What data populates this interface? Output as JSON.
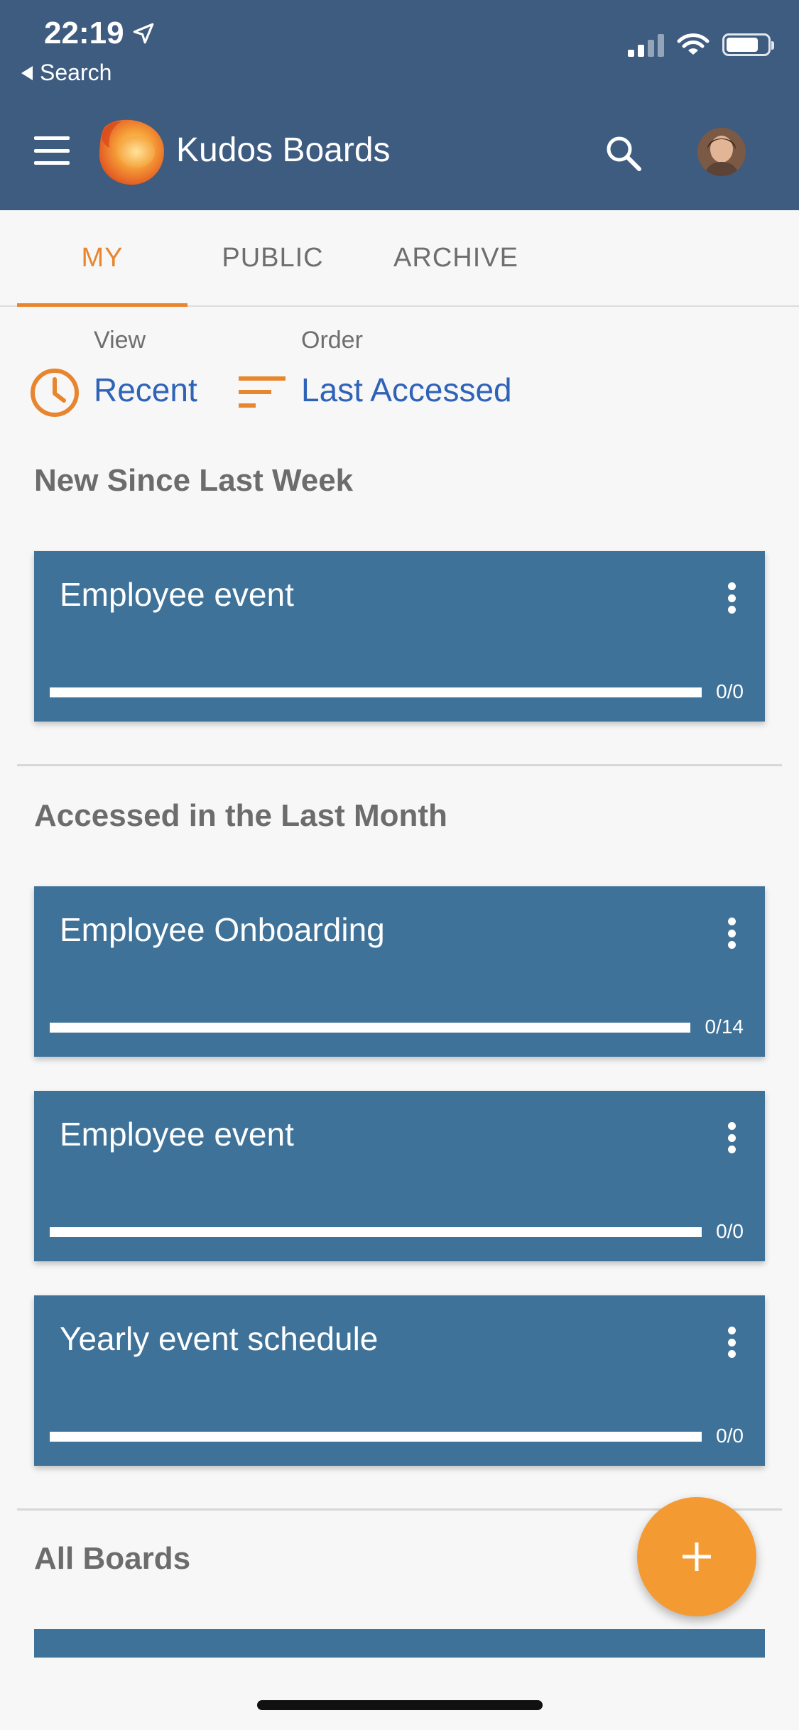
{
  "status_bar": {
    "time": "22:19",
    "back_label": "Search"
  },
  "app_bar": {
    "title": "Kudos Boards"
  },
  "tabs": [
    {
      "label": "MY",
      "active": true
    },
    {
      "label": "PUBLIC",
      "active": false
    },
    {
      "label": "ARCHIVE",
      "active": false
    }
  ],
  "filters": {
    "view_label": "View",
    "view_value": "Recent",
    "order_label": "Order",
    "order_value": "Last Accessed"
  },
  "sections": [
    {
      "title": "New Since Last Week",
      "cards": [
        {
          "title": "Employee  event",
          "count": "0/0"
        }
      ]
    },
    {
      "title": "Accessed in the Last Month",
      "cards": [
        {
          "title": "Employee Onboarding",
          "count": "0/14"
        },
        {
          "title": "Employee event",
          "count": "0/0"
        },
        {
          "title": "Yearly event schedule",
          "count": "0/0"
        }
      ]
    },
    {
      "title": "All Boards",
      "cards": []
    }
  ],
  "colors": {
    "header": "#3e5c80",
    "accent": "#e8862f",
    "link": "#2f63b8",
    "card": "#3f7299",
    "fab": "#f39a33"
  },
  "icons": {
    "menu": "hamburger-icon",
    "search": "search-icon",
    "view": "clock-icon",
    "order": "sort-icon",
    "card_menu": "more-vertical-icon",
    "fab": "plus-icon"
  }
}
